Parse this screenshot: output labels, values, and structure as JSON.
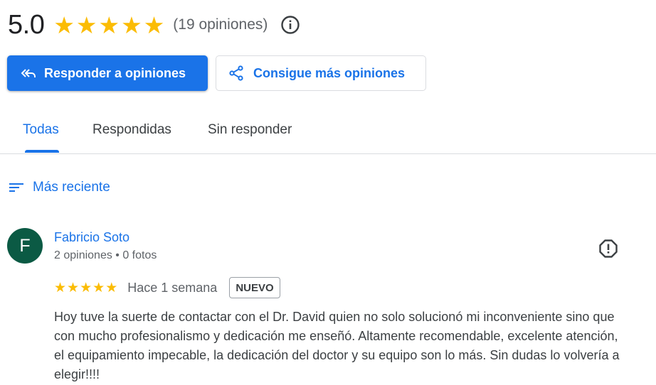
{
  "summary": {
    "rating": "5.0",
    "stars": 5,
    "count_label": "(19 opiniones)"
  },
  "actions": {
    "reply_label": "Responder a opiniones",
    "get_more_label": "Consigue más opiniones"
  },
  "tabs": [
    {
      "label": "Todas",
      "active": true
    },
    {
      "label": "Respondidas",
      "active": false
    },
    {
      "label": "Sin responder",
      "active": false
    }
  ],
  "sort": {
    "label": "Más reciente"
  },
  "review": {
    "avatar_initial": "F",
    "avatar_color": "#0b5a44",
    "name": "Fabricio Soto",
    "meta": "2 opiniones • 0 fotos",
    "stars": 5,
    "time": "Hace 1 semana",
    "badge": "NUEVO",
    "text": "Hoy tuve la suerte de contactar con el Dr. David quien no solo solucionó mi inconveniente sino que con mucho profesionalismo y dedicación me enseñó. Altamente recomendable, excelente atención, el equipamiento impecable, la dedicación del doctor y su equipo son lo más. Sin dudas lo volvería a elegir!!!!"
  },
  "icons": {
    "info": "info-icon",
    "reply": "reply-all-icon",
    "share": "share-icon",
    "sort": "sort-icon",
    "report": "report-icon"
  },
  "colors": {
    "accent": "#1a73e8",
    "star": "#fbbc04"
  }
}
